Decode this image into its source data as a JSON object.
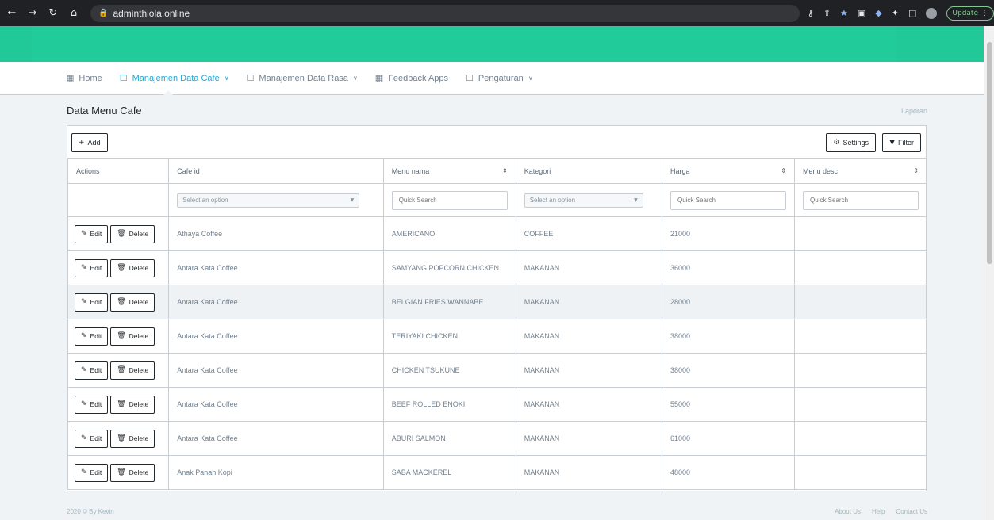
{
  "browser": {
    "url": "adminthiola.online",
    "update_label": "Update"
  },
  "nav": {
    "items": [
      {
        "label": "Home",
        "icon": "grid-icon"
      },
      {
        "label": "Manajemen Data Cafe",
        "icon": "box-icon",
        "active": true
      },
      {
        "label": "Manajemen Data Rasa",
        "icon": "box-icon"
      },
      {
        "label": "Feedback Apps",
        "icon": "grid-icon"
      },
      {
        "label": "Pengaturan",
        "icon": "box-icon"
      }
    ]
  },
  "page": {
    "title": "Data Menu Cafe",
    "breadcrumb": "Laporan"
  },
  "toolbar": {
    "add_label": "Add",
    "settings_label": "Settings",
    "filter_label": "Filter"
  },
  "table": {
    "columns": [
      "Actions",
      "Cafe id",
      "Menu nama",
      "Kategori",
      "Harga",
      "Menu desc"
    ],
    "filters": {
      "cafe_select": "Select an option",
      "menu_search": "Quick Search",
      "kategori_select": "Select an option",
      "harga_search": "Quick Search",
      "desc_search": "Quick Search"
    },
    "edit_label": "Edit",
    "delete_label": "Delete",
    "rows": [
      {
        "cafe": "Athaya Coffee",
        "menu": "AMERICANO",
        "kategori": "COFFEE",
        "harga": "21000",
        "desc": ""
      },
      {
        "cafe": "Antara Kata Coffee",
        "menu": "SAMYANG POPCORN CHICKEN",
        "kategori": "MAKANAN",
        "harga": "36000",
        "desc": ""
      },
      {
        "cafe": "Antara Kata Coffee",
        "menu": "BELGIAN FRIES WANNABE",
        "kategori": "MAKANAN",
        "harga": "28000",
        "desc": ""
      },
      {
        "cafe": "Antara Kata Coffee",
        "menu": "TERIYAKI CHICKEN",
        "kategori": "MAKANAN",
        "harga": "38000",
        "desc": ""
      },
      {
        "cafe": "Antara Kata Coffee",
        "menu": "CHICKEN TSUKUNE",
        "kategori": "MAKANAN",
        "harga": "38000",
        "desc": ""
      },
      {
        "cafe": "Antara Kata Coffee",
        "menu": "BEEF ROLLED ENOKI",
        "kategori": "MAKANAN",
        "harga": "55000",
        "desc": ""
      },
      {
        "cafe": "Antara Kata Coffee",
        "menu": "ABURI SALMON",
        "kategori": "MAKANAN",
        "harga": "61000",
        "desc": ""
      },
      {
        "cafe": "Anak Panah Kopi",
        "menu": "SABA MACKEREL",
        "kategori": "MAKANAN",
        "harga": "48000",
        "desc": ""
      }
    ]
  },
  "footer": {
    "copyright": "2020 © By Kevin",
    "links": [
      "About Us",
      "Help",
      "Contact Us"
    ]
  }
}
